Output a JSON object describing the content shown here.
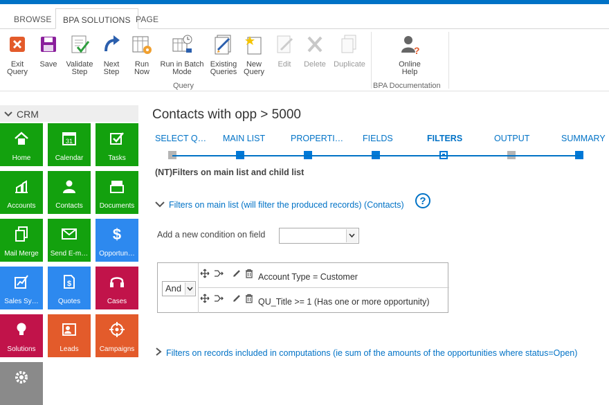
{
  "tabs": [
    "BROWSE",
    "BPA SOLUTIONS",
    "PAGE"
  ],
  "ribbon": {
    "exit_query": "Exit Query",
    "save": "Save",
    "validate_step": "Validate Step",
    "next_step": "Next Step",
    "run_now": "Run Now",
    "run_batch": "Run in Batch Mode",
    "existing_queries": "Existing Queries",
    "new_query": "New Query",
    "edit": "Edit",
    "delete": "Delete",
    "duplicate": "Duplicate",
    "online_help": "Online Help",
    "group_query": "Query",
    "group_docs": "BPA Documentation"
  },
  "sidebar": {
    "header": "CRM",
    "tiles": [
      {
        "label": "Home",
        "icon": "home-icon",
        "color": "#13a10e"
      },
      {
        "label": "Calendar",
        "icon": "calendar-icon",
        "color": "#13a10e",
        "icon_text": "31"
      },
      {
        "label": "Tasks",
        "icon": "tasks-icon",
        "color": "#13a10e"
      },
      {
        "label": "Accounts",
        "icon": "accounts-icon",
        "color": "#13a10e"
      },
      {
        "label": "Contacts",
        "icon": "contacts-icon",
        "color": "#13a10e"
      },
      {
        "label": "Documents",
        "icon": "documents-icon",
        "color": "#13a10e"
      },
      {
        "label": "Mail Merge",
        "icon": "mail-merge-icon",
        "color": "#13a10e"
      },
      {
        "label": "Send E-m…",
        "icon": "envelope-icon",
        "color": "#13a10e"
      },
      {
        "label": "Opportun…",
        "icon": "dollar-icon",
        "color": "#2d89ef"
      },
      {
        "label": "Sales Sy…",
        "icon": "sales-chart-icon",
        "color": "#2d89ef"
      },
      {
        "label": "Quotes",
        "icon": "quotes-icon",
        "color": "#2d89ef"
      },
      {
        "label": "Cases",
        "icon": "headset-icon",
        "color": "#c1134a"
      },
      {
        "label": "Solutions",
        "icon": "lightbulb-icon",
        "color": "#c1134a"
      },
      {
        "label": "Leads",
        "icon": "leads-icon",
        "color": "#e35b2b"
      },
      {
        "label": "Campaigns",
        "icon": "target-icon",
        "color": "#e35b2b"
      }
    ]
  },
  "main": {
    "title": "Contacts with opp > 5000",
    "steps": [
      "SELECT Q…",
      "MAIN LIST",
      "PROPERTI…",
      "FIELDS",
      "FILTERS",
      "OUTPUT",
      "SUMMARY"
    ],
    "subtitle": "(NT)Filters on main list and child list",
    "main_filters_link": "Filters on main list (will filter the produced records) (Contacts)",
    "help_glyph": "?",
    "add_condition_label": "Add a new condition on field",
    "operator": "And",
    "conditions": [
      "Account Type = Customer",
      "QU_Title >= 1 (Has one or more opportunity)"
    ],
    "computation_filters_link": "Filters on records included in computations (ie sum of the amounts of the opportunities where status=Open)"
  }
}
